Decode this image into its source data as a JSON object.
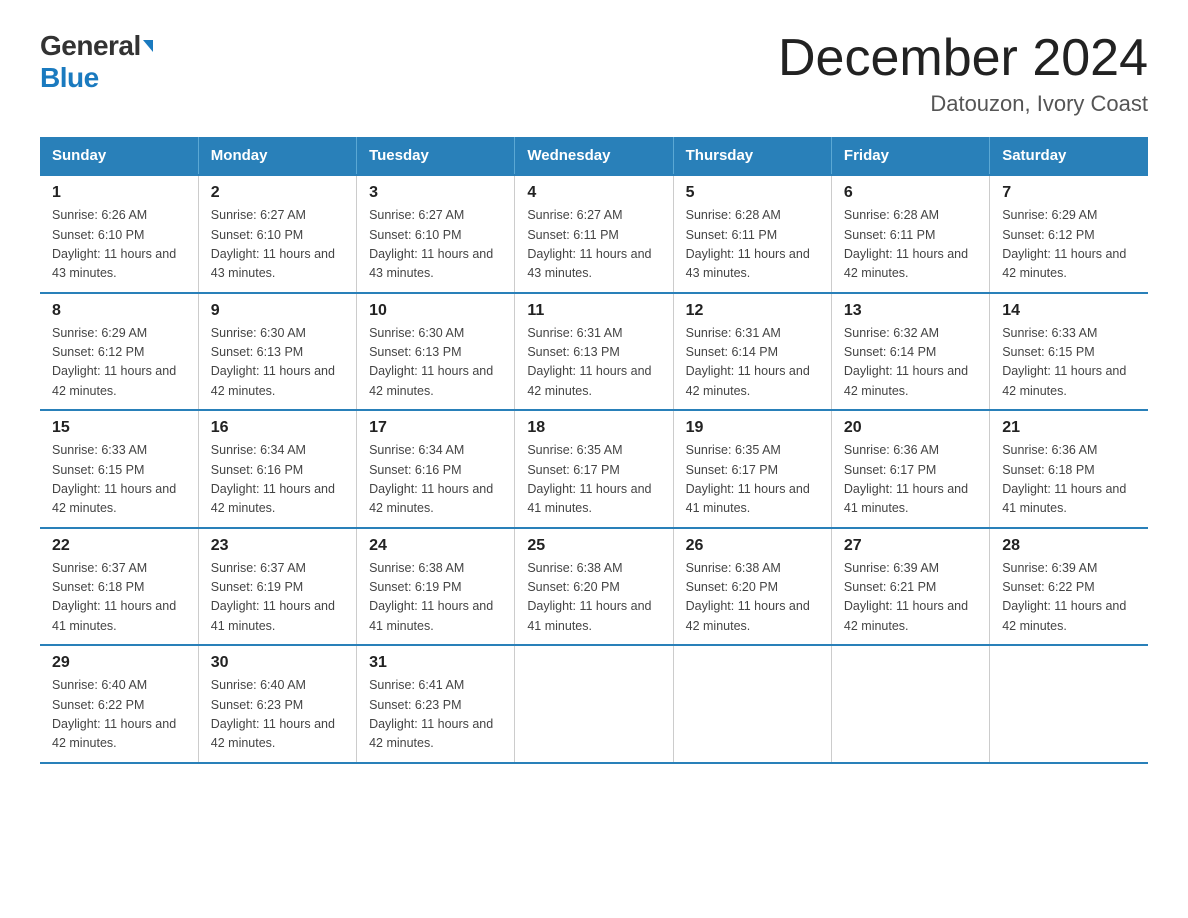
{
  "header": {
    "logo_general": "General",
    "logo_blue": "Blue",
    "month_title": "December 2024",
    "location": "Datouzon, Ivory Coast"
  },
  "days_of_week": [
    "Sunday",
    "Monday",
    "Tuesday",
    "Wednesday",
    "Thursday",
    "Friday",
    "Saturday"
  ],
  "weeks": [
    [
      {
        "day": "1",
        "sunrise": "Sunrise: 6:26 AM",
        "sunset": "Sunset: 6:10 PM",
        "daylight": "Daylight: 11 hours and 43 minutes."
      },
      {
        "day": "2",
        "sunrise": "Sunrise: 6:27 AM",
        "sunset": "Sunset: 6:10 PM",
        "daylight": "Daylight: 11 hours and 43 minutes."
      },
      {
        "day": "3",
        "sunrise": "Sunrise: 6:27 AM",
        "sunset": "Sunset: 6:10 PM",
        "daylight": "Daylight: 11 hours and 43 minutes."
      },
      {
        "day": "4",
        "sunrise": "Sunrise: 6:27 AM",
        "sunset": "Sunset: 6:11 PM",
        "daylight": "Daylight: 11 hours and 43 minutes."
      },
      {
        "day": "5",
        "sunrise": "Sunrise: 6:28 AM",
        "sunset": "Sunset: 6:11 PM",
        "daylight": "Daylight: 11 hours and 43 minutes."
      },
      {
        "day": "6",
        "sunrise": "Sunrise: 6:28 AM",
        "sunset": "Sunset: 6:11 PM",
        "daylight": "Daylight: 11 hours and 42 minutes."
      },
      {
        "day": "7",
        "sunrise": "Sunrise: 6:29 AM",
        "sunset": "Sunset: 6:12 PM",
        "daylight": "Daylight: 11 hours and 42 minutes."
      }
    ],
    [
      {
        "day": "8",
        "sunrise": "Sunrise: 6:29 AM",
        "sunset": "Sunset: 6:12 PM",
        "daylight": "Daylight: 11 hours and 42 minutes."
      },
      {
        "day": "9",
        "sunrise": "Sunrise: 6:30 AM",
        "sunset": "Sunset: 6:13 PM",
        "daylight": "Daylight: 11 hours and 42 minutes."
      },
      {
        "day": "10",
        "sunrise": "Sunrise: 6:30 AM",
        "sunset": "Sunset: 6:13 PM",
        "daylight": "Daylight: 11 hours and 42 minutes."
      },
      {
        "day": "11",
        "sunrise": "Sunrise: 6:31 AM",
        "sunset": "Sunset: 6:13 PM",
        "daylight": "Daylight: 11 hours and 42 minutes."
      },
      {
        "day": "12",
        "sunrise": "Sunrise: 6:31 AM",
        "sunset": "Sunset: 6:14 PM",
        "daylight": "Daylight: 11 hours and 42 minutes."
      },
      {
        "day": "13",
        "sunrise": "Sunrise: 6:32 AM",
        "sunset": "Sunset: 6:14 PM",
        "daylight": "Daylight: 11 hours and 42 minutes."
      },
      {
        "day": "14",
        "sunrise": "Sunrise: 6:33 AM",
        "sunset": "Sunset: 6:15 PM",
        "daylight": "Daylight: 11 hours and 42 minutes."
      }
    ],
    [
      {
        "day": "15",
        "sunrise": "Sunrise: 6:33 AM",
        "sunset": "Sunset: 6:15 PM",
        "daylight": "Daylight: 11 hours and 42 minutes."
      },
      {
        "day": "16",
        "sunrise": "Sunrise: 6:34 AM",
        "sunset": "Sunset: 6:16 PM",
        "daylight": "Daylight: 11 hours and 42 minutes."
      },
      {
        "day": "17",
        "sunrise": "Sunrise: 6:34 AM",
        "sunset": "Sunset: 6:16 PM",
        "daylight": "Daylight: 11 hours and 42 minutes."
      },
      {
        "day": "18",
        "sunrise": "Sunrise: 6:35 AM",
        "sunset": "Sunset: 6:17 PM",
        "daylight": "Daylight: 11 hours and 41 minutes."
      },
      {
        "day": "19",
        "sunrise": "Sunrise: 6:35 AM",
        "sunset": "Sunset: 6:17 PM",
        "daylight": "Daylight: 11 hours and 41 minutes."
      },
      {
        "day": "20",
        "sunrise": "Sunrise: 6:36 AM",
        "sunset": "Sunset: 6:17 PM",
        "daylight": "Daylight: 11 hours and 41 minutes."
      },
      {
        "day": "21",
        "sunrise": "Sunrise: 6:36 AM",
        "sunset": "Sunset: 6:18 PM",
        "daylight": "Daylight: 11 hours and 41 minutes."
      }
    ],
    [
      {
        "day": "22",
        "sunrise": "Sunrise: 6:37 AM",
        "sunset": "Sunset: 6:18 PM",
        "daylight": "Daylight: 11 hours and 41 minutes."
      },
      {
        "day": "23",
        "sunrise": "Sunrise: 6:37 AM",
        "sunset": "Sunset: 6:19 PM",
        "daylight": "Daylight: 11 hours and 41 minutes."
      },
      {
        "day": "24",
        "sunrise": "Sunrise: 6:38 AM",
        "sunset": "Sunset: 6:19 PM",
        "daylight": "Daylight: 11 hours and 41 minutes."
      },
      {
        "day": "25",
        "sunrise": "Sunrise: 6:38 AM",
        "sunset": "Sunset: 6:20 PM",
        "daylight": "Daylight: 11 hours and 41 minutes."
      },
      {
        "day": "26",
        "sunrise": "Sunrise: 6:38 AM",
        "sunset": "Sunset: 6:20 PM",
        "daylight": "Daylight: 11 hours and 42 minutes."
      },
      {
        "day": "27",
        "sunrise": "Sunrise: 6:39 AM",
        "sunset": "Sunset: 6:21 PM",
        "daylight": "Daylight: 11 hours and 42 minutes."
      },
      {
        "day": "28",
        "sunrise": "Sunrise: 6:39 AM",
        "sunset": "Sunset: 6:22 PM",
        "daylight": "Daylight: 11 hours and 42 minutes."
      }
    ],
    [
      {
        "day": "29",
        "sunrise": "Sunrise: 6:40 AM",
        "sunset": "Sunset: 6:22 PM",
        "daylight": "Daylight: 11 hours and 42 minutes."
      },
      {
        "day": "30",
        "sunrise": "Sunrise: 6:40 AM",
        "sunset": "Sunset: 6:23 PM",
        "daylight": "Daylight: 11 hours and 42 minutes."
      },
      {
        "day": "31",
        "sunrise": "Sunrise: 6:41 AM",
        "sunset": "Sunset: 6:23 PM",
        "daylight": "Daylight: 11 hours and 42 minutes."
      },
      {
        "day": "",
        "sunrise": "",
        "sunset": "",
        "daylight": ""
      },
      {
        "day": "",
        "sunrise": "",
        "sunset": "",
        "daylight": ""
      },
      {
        "day": "",
        "sunrise": "",
        "sunset": "",
        "daylight": ""
      },
      {
        "day": "",
        "sunrise": "",
        "sunset": "",
        "daylight": ""
      }
    ]
  ]
}
